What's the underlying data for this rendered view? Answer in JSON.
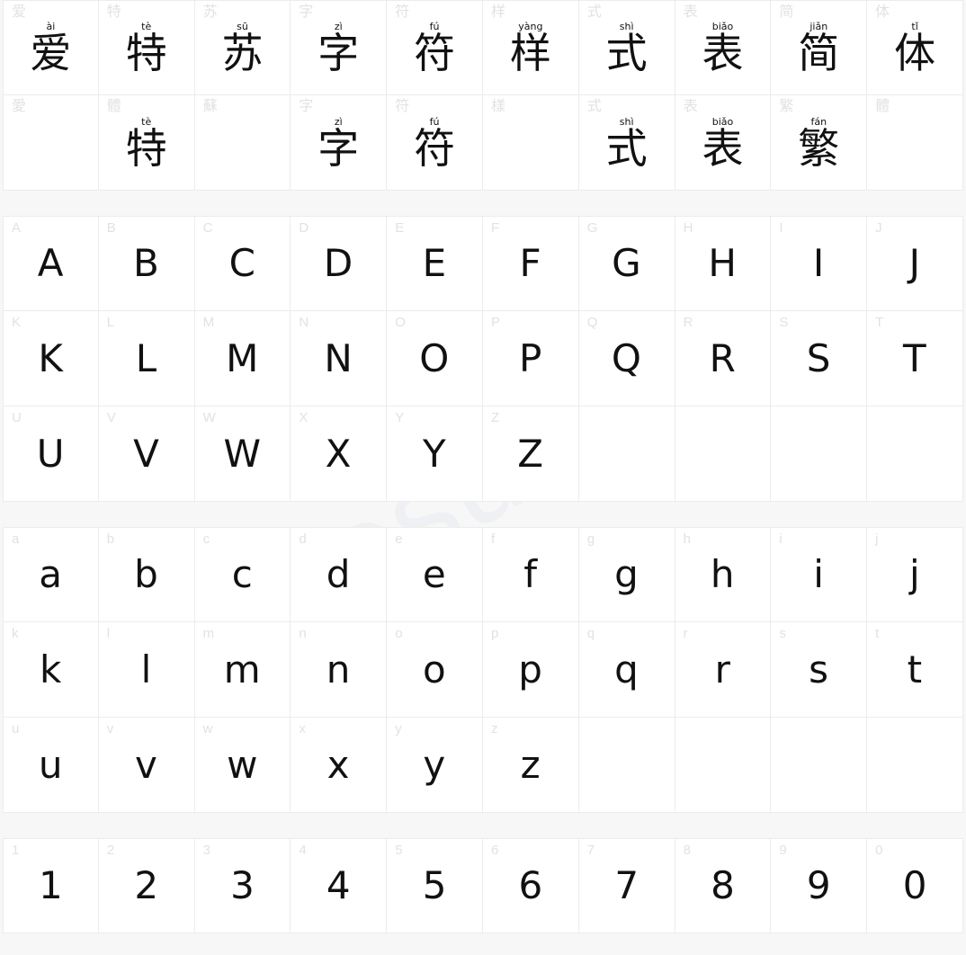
{
  "page": {
    "title": "Font Specimen Character Map",
    "background_color": "#f7f7f8",
    "cell_background_color": "#ffffff",
    "grid_line_color": "#ececec",
    "label_color": "#e2e2e4",
    "glyph_color": "#111111",
    "watermark_color": "#eef0f3"
  },
  "watermark": {
    "text": "aitesu.com",
    "rotation_deg": -31
  },
  "sections": [
    {
      "name": "chinese-sample",
      "rows": [
        [
          {
            "label": "爱",
            "pinyin": "ài",
            "glyph": "爱",
            "script": "cjk"
          },
          {
            "label": "特",
            "pinyin": "tè",
            "glyph": "特",
            "script": "cjk"
          },
          {
            "label": "苏",
            "pinyin": "sū",
            "glyph": "苏",
            "script": "cjk"
          },
          {
            "label": "字",
            "pinyin": "zì",
            "glyph": "字",
            "script": "cjk"
          },
          {
            "label": "符",
            "pinyin": "fú",
            "glyph": "符",
            "script": "cjk"
          },
          {
            "label": "样",
            "pinyin": "yàng",
            "glyph": "样",
            "script": "cjk"
          },
          {
            "label": "式",
            "pinyin": "shì",
            "glyph": "式",
            "script": "cjk"
          },
          {
            "label": "表",
            "pinyin": "biǎo",
            "glyph": "表",
            "script": "cjk"
          },
          {
            "label": "简",
            "pinyin": "jiǎn",
            "glyph": "简",
            "script": "cjk"
          },
          {
            "label": "体",
            "pinyin": "tǐ",
            "glyph": "体",
            "script": "cjk"
          }
        ],
        [
          {
            "label": "愛",
            "pinyin": "",
            "glyph": "",
            "script": "cjk"
          },
          {
            "label": "體",
            "pinyin": "tè",
            "glyph": "特",
            "script": "cjk"
          },
          {
            "label": "蘇",
            "pinyin": "",
            "glyph": "",
            "script": "cjk"
          },
          {
            "label": "字",
            "pinyin": "zì",
            "glyph": "字",
            "script": "cjk"
          },
          {
            "label": "符",
            "pinyin": "fú",
            "glyph": "符",
            "script": "cjk"
          },
          {
            "label": "樣",
            "pinyin": "",
            "glyph": "",
            "script": "cjk"
          },
          {
            "label": "式",
            "pinyin": "shì",
            "glyph": "式",
            "script": "cjk"
          },
          {
            "label": "表",
            "pinyin": "biǎo",
            "glyph": "表",
            "script": "cjk"
          },
          {
            "label": "繁",
            "pinyin": "fán",
            "glyph": "繁",
            "script": "cjk"
          },
          {
            "label": "體",
            "pinyin": "",
            "glyph": "",
            "script": "cjk"
          }
        ]
      ]
    },
    {
      "name": "uppercase-latin",
      "rows": [
        [
          {
            "label": "A",
            "pinyin": "",
            "glyph": "A",
            "script": "latin"
          },
          {
            "label": "B",
            "pinyin": "",
            "glyph": "B",
            "script": "latin"
          },
          {
            "label": "C",
            "pinyin": "",
            "glyph": "C",
            "script": "latin"
          },
          {
            "label": "D",
            "pinyin": "",
            "glyph": "D",
            "script": "latin"
          },
          {
            "label": "E",
            "pinyin": "",
            "glyph": "E",
            "script": "latin"
          },
          {
            "label": "F",
            "pinyin": "",
            "glyph": "F",
            "script": "latin"
          },
          {
            "label": "G",
            "pinyin": "",
            "glyph": "G",
            "script": "latin"
          },
          {
            "label": "H",
            "pinyin": "",
            "glyph": "H",
            "script": "latin"
          },
          {
            "label": "I",
            "pinyin": "",
            "glyph": "I",
            "script": "latin"
          },
          {
            "label": "J",
            "pinyin": "",
            "glyph": "J",
            "script": "latin"
          }
        ],
        [
          {
            "label": "K",
            "pinyin": "",
            "glyph": "K",
            "script": "latin"
          },
          {
            "label": "L",
            "pinyin": "",
            "glyph": "L",
            "script": "latin"
          },
          {
            "label": "M",
            "pinyin": "",
            "glyph": "M",
            "script": "latin"
          },
          {
            "label": "N",
            "pinyin": "",
            "glyph": "N",
            "script": "latin"
          },
          {
            "label": "O",
            "pinyin": "",
            "glyph": "O",
            "script": "latin"
          },
          {
            "label": "P",
            "pinyin": "",
            "glyph": "P",
            "script": "latin"
          },
          {
            "label": "Q",
            "pinyin": "",
            "glyph": "Q",
            "script": "latin"
          },
          {
            "label": "R",
            "pinyin": "",
            "glyph": "R",
            "script": "latin"
          },
          {
            "label": "S",
            "pinyin": "",
            "glyph": "S",
            "script": "latin"
          },
          {
            "label": "T",
            "pinyin": "",
            "glyph": "T",
            "script": "latin"
          }
        ],
        [
          {
            "label": "U",
            "pinyin": "",
            "glyph": "U",
            "script": "latin"
          },
          {
            "label": "V",
            "pinyin": "",
            "glyph": "V",
            "script": "latin"
          },
          {
            "label": "W",
            "pinyin": "",
            "glyph": "W",
            "script": "latin"
          },
          {
            "label": "X",
            "pinyin": "",
            "glyph": "X",
            "script": "latin"
          },
          {
            "label": "Y",
            "pinyin": "",
            "glyph": "Y",
            "script": "latin"
          },
          {
            "label": "Z",
            "pinyin": "",
            "glyph": "Z",
            "script": "latin"
          },
          {
            "label": "",
            "pinyin": "",
            "glyph": "",
            "script": "latin"
          },
          {
            "label": "",
            "pinyin": "",
            "glyph": "",
            "script": "latin"
          },
          {
            "label": "",
            "pinyin": "",
            "glyph": "",
            "script": "latin"
          },
          {
            "label": "",
            "pinyin": "",
            "glyph": "",
            "script": "latin"
          }
        ]
      ]
    },
    {
      "name": "lowercase-latin",
      "rows": [
        [
          {
            "label": "a",
            "pinyin": "",
            "glyph": "a",
            "script": "latin"
          },
          {
            "label": "b",
            "pinyin": "",
            "glyph": "b",
            "script": "latin"
          },
          {
            "label": "c",
            "pinyin": "",
            "glyph": "c",
            "script": "latin"
          },
          {
            "label": "d",
            "pinyin": "",
            "glyph": "d",
            "script": "latin"
          },
          {
            "label": "e",
            "pinyin": "",
            "glyph": "e",
            "script": "latin"
          },
          {
            "label": "f",
            "pinyin": "",
            "glyph": "f",
            "script": "latin"
          },
          {
            "label": "g",
            "pinyin": "",
            "glyph": "g",
            "script": "latin"
          },
          {
            "label": "h",
            "pinyin": "",
            "glyph": "h",
            "script": "latin"
          },
          {
            "label": "i",
            "pinyin": "",
            "glyph": "i",
            "script": "latin"
          },
          {
            "label": "j",
            "pinyin": "",
            "glyph": "j",
            "script": "latin"
          }
        ],
        [
          {
            "label": "k",
            "pinyin": "",
            "glyph": "k",
            "script": "latin"
          },
          {
            "label": "l",
            "pinyin": "",
            "glyph": "l",
            "script": "latin"
          },
          {
            "label": "m",
            "pinyin": "",
            "glyph": "m",
            "script": "latin"
          },
          {
            "label": "n",
            "pinyin": "",
            "glyph": "n",
            "script": "latin"
          },
          {
            "label": "o",
            "pinyin": "",
            "glyph": "o",
            "script": "latin"
          },
          {
            "label": "p",
            "pinyin": "",
            "glyph": "p",
            "script": "latin"
          },
          {
            "label": "q",
            "pinyin": "",
            "glyph": "q",
            "script": "latin"
          },
          {
            "label": "r",
            "pinyin": "",
            "glyph": "r",
            "script": "latin"
          },
          {
            "label": "s",
            "pinyin": "",
            "glyph": "s",
            "script": "latin"
          },
          {
            "label": "t",
            "pinyin": "",
            "glyph": "t",
            "script": "latin"
          }
        ],
        [
          {
            "label": "u",
            "pinyin": "",
            "glyph": "u",
            "script": "latin"
          },
          {
            "label": "v",
            "pinyin": "",
            "glyph": "v",
            "script": "latin"
          },
          {
            "label": "w",
            "pinyin": "",
            "glyph": "w",
            "script": "latin"
          },
          {
            "label": "x",
            "pinyin": "",
            "glyph": "x",
            "script": "latin"
          },
          {
            "label": "y",
            "pinyin": "",
            "glyph": "y",
            "script": "latin"
          },
          {
            "label": "z",
            "pinyin": "",
            "glyph": "z",
            "script": "latin"
          },
          {
            "label": "",
            "pinyin": "",
            "glyph": "",
            "script": "latin"
          },
          {
            "label": "",
            "pinyin": "",
            "glyph": "",
            "script": "latin"
          },
          {
            "label": "",
            "pinyin": "",
            "glyph": "",
            "script": "latin"
          },
          {
            "label": "",
            "pinyin": "",
            "glyph": "",
            "script": "latin"
          }
        ]
      ]
    },
    {
      "name": "digits",
      "rows": [
        [
          {
            "label": "1",
            "pinyin": "",
            "glyph": "1",
            "script": "digit"
          },
          {
            "label": "2",
            "pinyin": "",
            "glyph": "2",
            "script": "digit"
          },
          {
            "label": "3",
            "pinyin": "",
            "glyph": "3",
            "script": "digit"
          },
          {
            "label": "4",
            "pinyin": "",
            "glyph": "4",
            "script": "digit"
          },
          {
            "label": "5",
            "pinyin": "",
            "glyph": "5",
            "script": "digit"
          },
          {
            "label": "6",
            "pinyin": "",
            "glyph": "6",
            "script": "digit"
          },
          {
            "label": "7",
            "pinyin": "",
            "glyph": "7",
            "script": "digit"
          },
          {
            "label": "8",
            "pinyin": "",
            "glyph": "8",
            "script": "digit"
          },
          {
            "label": "9",
            "pinyin": "",
            "glyph": "9",
            "script": "digit"
          },
          {
            "label": "0",
            "pinyin": "",
            "glyph": "0",
            "script": "digit"
          }
        ]
      ]
    }
  ]
}
